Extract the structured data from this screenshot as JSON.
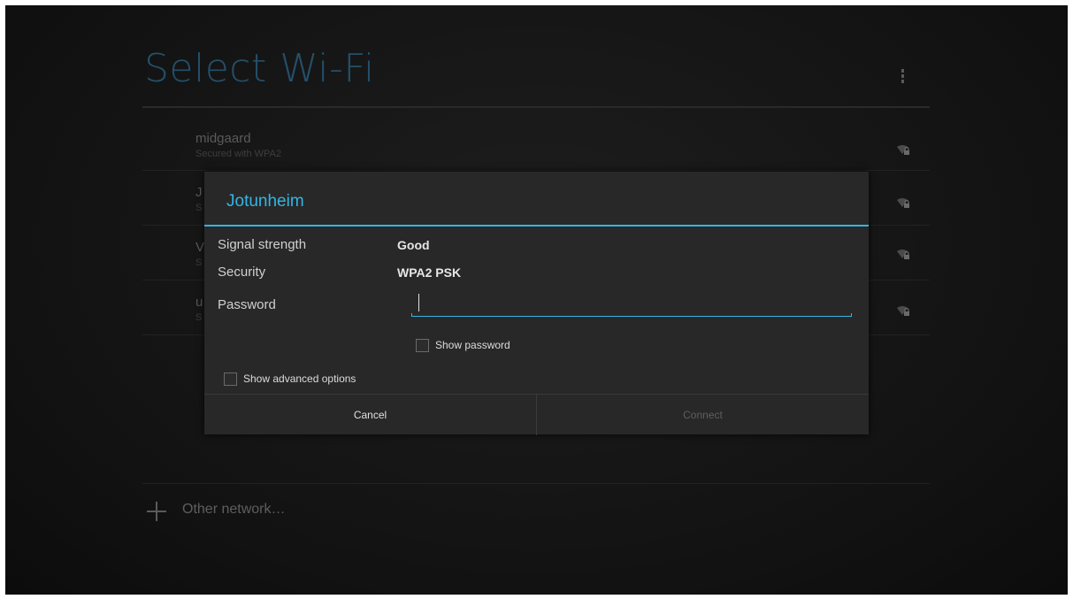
{
  "screen": {
    "title": "Select Wi-Fi",
    "overflow_icon": "overflow-menu-icon"
  },
  "networks": [
    {
      "name": "midgaard",
      "security": "Secured with WPA2",
      "icon": "wifi-locked-icon"
    },
    {
      "name": "J",
      "security": "S",
      "icon": "wifi-locked-icon"
    },
    {
      "name": "V",
      "security": "S",
      "icon": "wifi-locked-icon"
    },
    {
      "name": "u",
      "security": "S",
      "icon": "wifi-locked-icon"
    }
  ],
  "other_network": {
    "label": "Other network…",
    "icon": "plus-icon"
  },
  "dialog": {
    "title": "Jotunheim",
    "signal_label": "Signal strength",
    "signal_value": "Good",
    "security_label": "Security",
    "security_value": "WPA2 PSK",
    "password_label": "Password",
    "password_value": "",
    "show_password_label": "Show password",
    "show_password_checked": false,
    "advanced_label": "Show advanced options",
    "advanced_checked": false,
    "cancel_label": "Cancel",
    "connect_label": "Connect",
    "connect_enabled": false
  },
  "colors": {
    "accent": "#33b5e5",
    "title": "#24506a",
    "background": "#121212",
    "dialog": "#282828"
  }
}
